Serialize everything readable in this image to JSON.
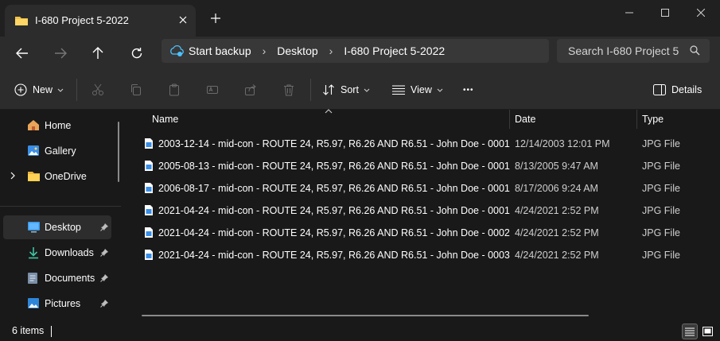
{
  "window": {
    "tab_title": "I-680 Project 5-2022",
    "new_tab_symbol": "+"
  },
  "address": {
    "crumbs": [
      "Start backup",
      "Desktop",
      "I-680 Project 5-2022"
    ],
    "separator": "›",
    "search_placeholder": "Search I-680 Project 5"
  },
  "commands": {
    "new_label": "New",
    "sort_label": "Sort",
    "view_label": "View",
    "more_label": "•••",
    "details_label": "Details"
  },
  "sidebar": {
    "items": [
      {
        "label": "Home",
        "icon": "home-icon"
      },
      {
        "label": "Gallery",
        "icon": "gallery-icon"
      },
      {
        "label": "OneDrive",
        "icon": "folder-icon"
      },
      {
        "label": "Desktop",
        "icon": "desktop-icon"
      },
      {
        "label": "Downloads",
        "icon": "download-icon"
      },
      {
        "label": "Documents",
        "icon": "document-icon"
      },
      {
        "label": "Pictures",
        "icon": "pictures-icon"
      }
    ]
  },
  "columns": {
    "name": "Name",
    "date": "Date",
    "type": "Type"
  },
  "files": [
    {
      "name": "2003-12-14 - mid-con - ROUTE 24, R5.97, R6.26 AND R6.51 - John Doe - 0001",
      "date": "12/14/2003 12:01 PM",
      "type": "JPG File"
    },
    {
      "name": "2005-08-13 - mid-con - ROUTE 24, R5.97, R6.26 AND R6.51 - John Doe - 0001",
      "date": "8/13/2005 9:47 AM",
      "type": "JPG File"
    },
    {
      "name": "2006-08-17 - mid-con - ROUTE 24, R5.97, R6.26 AND R6.51 - John Doe - 0001",
      "date": "8/17/2006 9:24 AM",
      "type": "JPG File"
    },
    {
      "name": "2021-04-24 - mid-con - ROUTE 24, R5.97, R6.26 AND R6.51 - John Doe - 0001",
      "date": "4/24/2021 2:52 PM",
      "type": "JPG File"
    },
    {
      "name": "2021-04-24 - mid-con - ROUTE 24, R5.97, R6.26 AND R6.51 - John Doe - 0002",
      "date": "4/24/2021 2:52 PM",
      "type": "JPG File"
    },
    {
      "name": "2021-04-24 - mid-con - ROUTE 24, R5.97, R6.26 AND R6.51 - John Doe - 0003",
      "date": "4/24/2021 2:52 PM",
      "type": "JPG File"
    }
  ],
  "status": {
    "item_count": "6 items"
  },
  "colors": {
    "accent": "#4cc2ff",
    "folder": "#f0c24b",
    "background": "#191919",
    "toolbar": "#2c2c2c"
  }
}
